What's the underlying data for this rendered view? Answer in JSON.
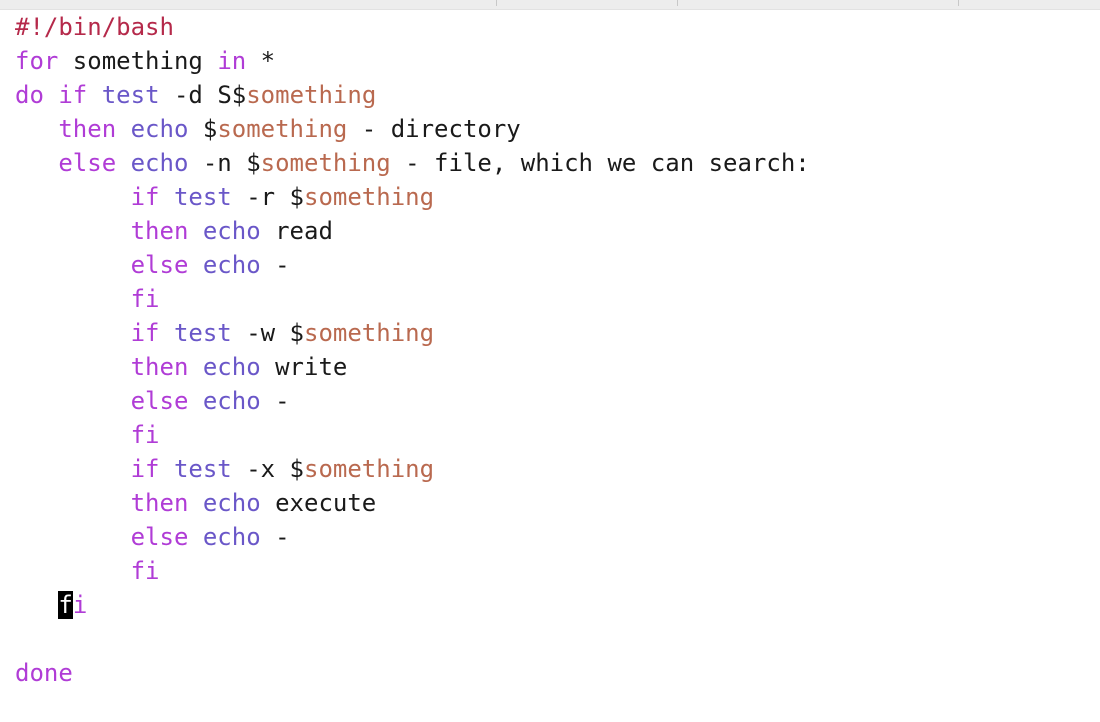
{
  "editor": {
    "lines": [
      [
        {
          "t": "#!/bin/bash",
          "k": "shebang"
        }
      ],
      [
        {
          "t": "for",
          "k": "keyword"
        },
        {
          "t": " something ",
          "k": "text"
        },
        {
          "t": "in",
          "k": "keyword"
        },
        {
          "t": " *",
          "k": "text"
        }
      ],
      [
        {
          "t": "do",
          "k": "keyword"
        },
        {
          "t": " ",
          "k": "text"
        },
        {
          "t": "if",
          "k": "keyword"
        },
        {
          "t": " ",
          "k": "text"
        },
        {
          "t": "test",
          "k": "builtin"
        },
        {
          "t": " -d S$",
          "k": "text"
        },
        {
          "t": "something",
          "k": "var"
        }
      ],
      [
        {
          "t": "   ",
          "k": "text"
        },
        {
          "t": "then",
          "k": "keyword"
        },
        {
          "t": " ",
          "k": "text"
        },
        {
          "t": "echo",
          "k": "builtin"
        },
        {
          "t": " $",
          "k": "text"
        },
        {
          "t": "something",
          "k": "var"
        },
        {
          "t": " - directory",
          "k": "text"
        }
      ],
      [
        {
          "t": "   ",
          "k": "text"
        },
        {
          "t": "else",
          "k": "keyword"
        },
        {
          "t": " ",
          "k": "text"
        },
        {
          "t": "echo",
          "k": "builtin"
        },
        {
          "t": " -n $",
          "k": "text"
        },
        {
          "t": "something",
          "k": "var"
        },
        {
          "t": " - file, which we can search:",
          "k": "text"
        }
      ],
      [
        {
          "t": "        ",
          "k": "text"
        },
        {
          "t": "if",
          "k": "keyword"
        },
        {
          "t": " ",
          "k": "text"
        },
        {
          "t": "test",
          "k": "builtin"
        },
        {
          "t": " -r $",
          "k": "text"
        },
        {
          "t": "something",
          "k": "var"
        }
      ],
      [
        {
          "t": "        ",
          "k": "text"
        },
        {
          "t": "then",
          "k": "keyword"
        },
        {
          "t": " ",
          "k": "text"
        },
        {
          "t": "echo",
          "k": "builtin"
        },
        {
          "t": " read",
          "k": "text"
        }
      ],
      [
        {
          "t": "        ",
          "k": "text"
        },
        {
          "t": "else",
          "k": "keyword"
        },
        {
          "t": " ",
          "k": "text"
        },
        {
          "t": "echo",
          "k": "builtin"
        },
        {
          "t": " -",
          "k": "text"
        }
      ],
      [
        {
          "t": "        ",
          "k": "text"
        },
        {
          "t": "fi",
          "k": "keyword"
        }
      ],
      [
        {
          "t": "        ",
          "k": "text"
        },
        {
          "t": "if",
          "k": "keyword"
        },
        {
          "t": " ",
          "k": "text"
        },
        {
          "t": "test",
          "k": "builtin"
        },
        {
          "t": " -w $",
          "k": "text"
        },
        {
          "t": "something",
          "k": "var"
        }
      ],
      [
        {
          "t": "        ",
          "k": "text"
        },
        {
          "t": "then",
          "k": "keyword"
        },
        {
          "t": " ",
          "k": "text"
        },
        {
          "t": "echo",
          "k": "builtin"
        },
        {
          "t": " write",
          "k": "text"
        }
      ],
      [
        {
          "t": "        ",
          "k": "text"
        },
        {
          "t": "else",
          "k": "keyword"
        },
        {
          "t": " ",
          "k": "text"
        },
        {
          "t": "echo",
          "k": "builtin"
        },
        {
          "t": " -",
          "k": "text"
        }
      ],
      [
        {
          "t": "        ",
          "k": "text"
        },
        {
          "t": "fi",
          "k": "keyword"
        }
      ],
      [
        {
          "t": "        ",
          "k": "text"
        },
        {
          "t": "if",
          "k": "keyword"
        },
        {
          "t": " ",
          "k": "text"
        },
        {
          "t": "test",
          "k": "builtin"
        },
        {
          "t": " -x $",
          "k": "text"
        },
        {
          "t": "something",
          "k": "var"
        }
      ],
      [
        {
          "t": "        ",
          "k": "text"
        },
        {
          "t": "then",
          "k": "keyword"
        },
        {
          "t": " ",
          "k": "text"
        },
        {
          "t": "echo",
          "k": "builtin"
        },
        {
          "t": " execute",
          "k": "text"
        }
      ],
      [
        {
          "t": "        ",
          "k": "text"
        },
        {
          "t": "else",
          "k": "keyword"
        },
        {
          "t": " ",
          "k": "text"
        },
        {
          "t": "echo",
          "k": "builtin"
        },
        {
          "t": " -",
          "k": "text"
        }
      ],
      [
        {
          "t": "        ",
          "k": "text"
        },
        {
          "t": "fi",
          "k": "keyword"
        }
      ],
      [
        {
          "t": "   ",
          "k": "text"
        },
        {
          "t": "f",
          "k": "cursor"
        },
        {
          "t": "i",
          "k": "keyword"
        }
      ],
      [],
      [
        {
          "t": "done",
          "k": "keyword"
        }
      ]
    ]
  },
  "colors": {
    "shebang": "#b5294a",
    "keyword": "#b03cd6",
    "builtin": "#6a57c8",
    "variable": "#b9694f",
    "text": "#1a1a1a",
    "cursor_bg": "#000000",
    "cursor_fg": "#ffffff"
  }
}
